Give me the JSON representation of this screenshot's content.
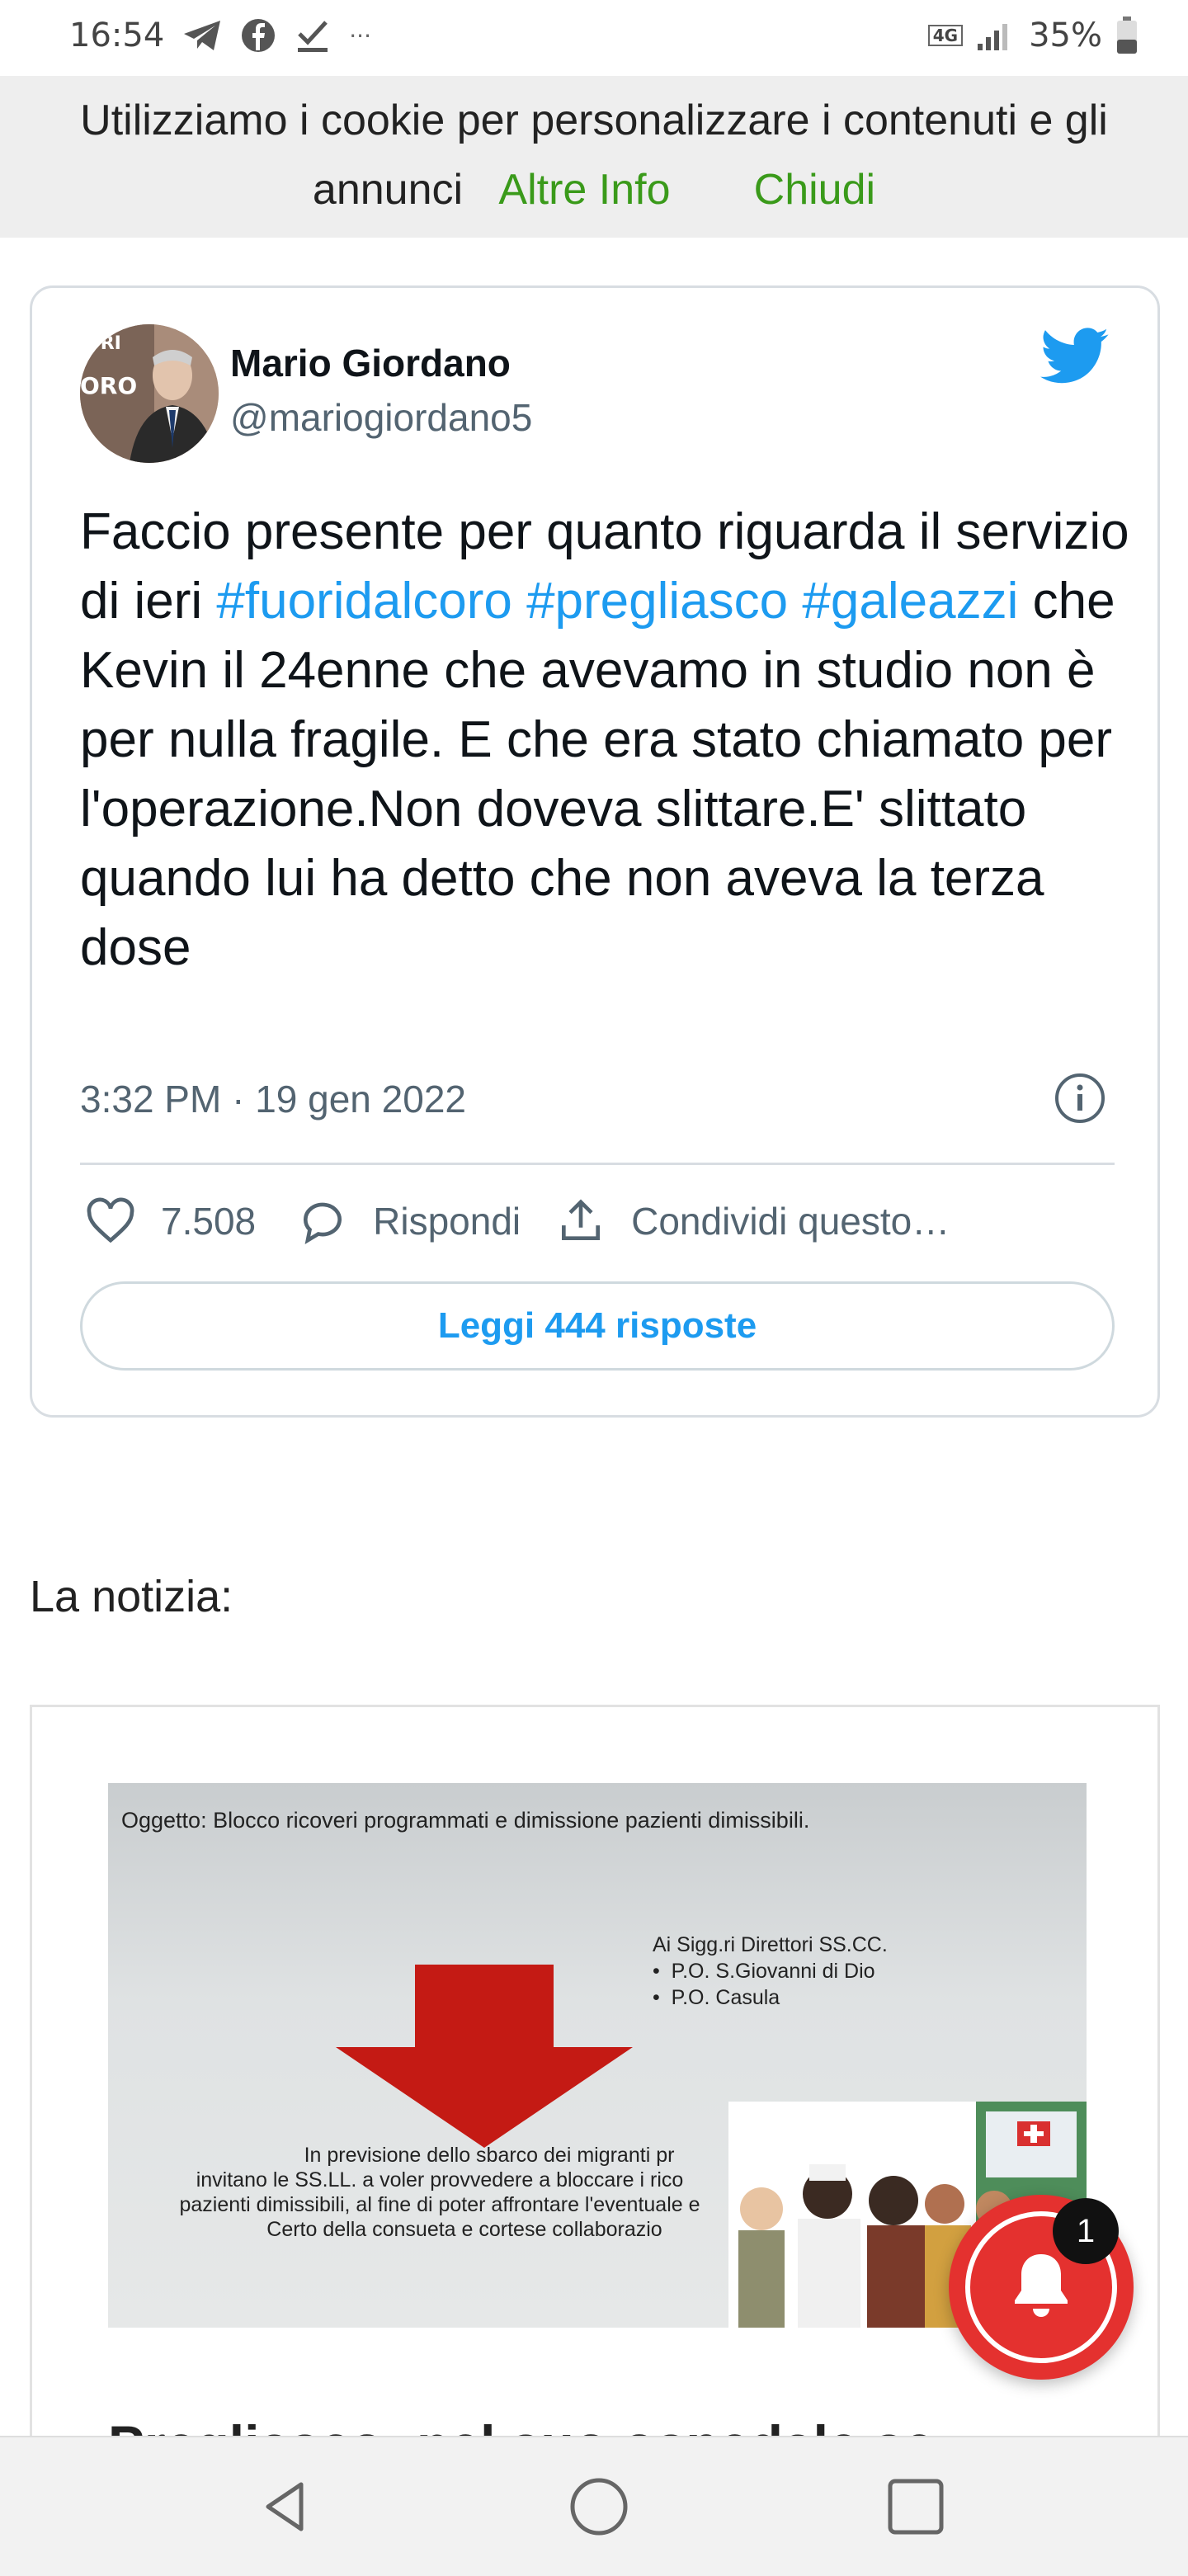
{
  "status_bar": {
    "time": "16:54",
    "network": "4G",
    "battery": "35%",
    "icons": [
      "telegram-icon",
      "facebook-icon",
      "download-done-icon",
      "more-icon",
      "signal-icon",
      "battery-icon"
    ]
  },
  "cookie_banner": {
    "text_line1": "Utilizziamo i cookie per personalizzare i contenuti e gli",
    "text_line2": "annunci",
    "more_info": "Altre Info",
    "close": "Chiudi"
  },
  "tweet": {
    "author_name": "Mario Giordano",
    "author_handle": "@mariogiordano5",
    "avatar_text_top": "ORI",
    "avatar_text_bottom": "ORO",
    "text_part1": "Faccio presente per quanto riguarda il servizio di ieri ",
    "hashtag1": "#fuoridalcoro",
    "hashtag2": "#pregliasco",
    "hashtag3": "#galeazzi",
    "text_part2": " che Kevin il 24enne che avevamo in studio non è per nulla fragile. E che era stato chiamato per l'operazione.Non doveva slittare.E' slittato quando lui ha detto che non aveva la terza dose",
    "timestamp": "3:32 PM · 19 gen 2022",
    "likes": "7.508",
    "reply_label": "Rispondi",
    "share_label": "Condividi questo…",
    "read_replies": "Leggi 444 risposte"
  },
  "news_label": "La notizia:",
  "article": {
    "image": {
      "subject": "Oggetto: Blocco ricoveri programmati e dimissione pazienti dimissibili.",
      "recipient_header": "Ai Sigg.ri Direttori SS.CC.",
      "recipients": [
        "P.O. S.Giovanni di Dio",
        "P.O. Casula"
      ],
      "body_lines": [
        "In previsione dello sbarco dei migranti pr",
        "invitano le SS.LL. a voler provvedere a bloccare i rico",
        "pazienti dimissibili, al fine di poter affrontare l'eventuale e",
        "Certo della consueta e cortese collaborazio"
      ]
    },
    "title": "Pregliasco: nel suo ospedale se"
  },
  "notification": {
    "badge_count": "1"
  },
  "colors": {
    "twitter_blue": "#1d9bf0",
    "cookie_link_green": "#3a9a1a",
    "bell_red": "#e4312f"
  }
}
